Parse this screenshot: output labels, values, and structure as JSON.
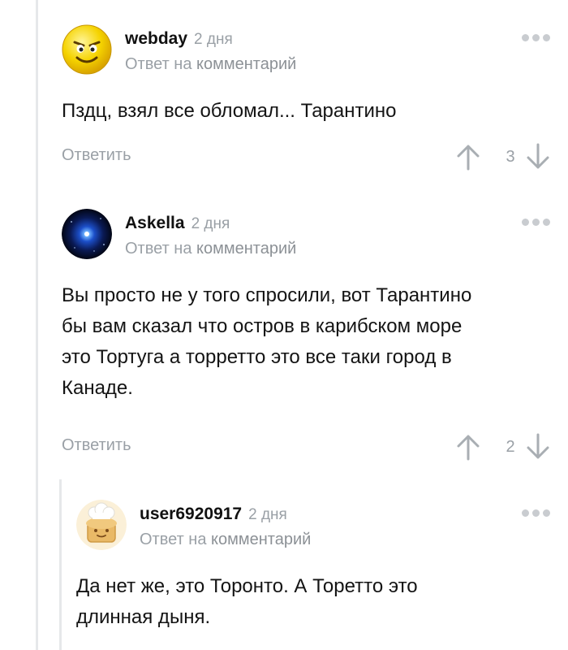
{
  "comments": [
    {
      "author": "webday",
      "time": "2 дня",
      "reply_prefix": "Ответ на",
      "reply_link": "комментарий",
      "text": "Пздц, взял все обломал... Тарантино",
      "reply_button": "Ответить",
      "rating": "3",
      "avatar_icon": "angry-smiley-avatar"
    },
    {
      "author": "Askella",
      "time": "2 дня",
      "reply_prefix": "Ответ на",
      "reply_link": "комментарий",
      "text_lines": [
        "Вы просто не у того спросили, вот Тарантино",
        "бы вам сказал что остров в карибском море",
        "это Тортуга а торретто это все таки город в",
        "Канаде."
      ],
      "reply_button": "Ответить",
      "rating": "2",
      "avatar_icon": "blue-star-avatar"
    },
    {
      "author": "user6920917",
      "time": "2 дня",
      "reply_prefix": "Ответ на",
      "reply_link": "комментарий",
      "text_lines": [
        "Да нет же, это Торонто. А Торетто это",
        "длинная дыня."
      ],
      "avatar_icon": "chef-toast-avatar"
    }
  ],
  "colors": {
    "muted": "#9aa0a6",
    "thread_line": "#e6e8ea",
    "text": "#141414"
  }
}
